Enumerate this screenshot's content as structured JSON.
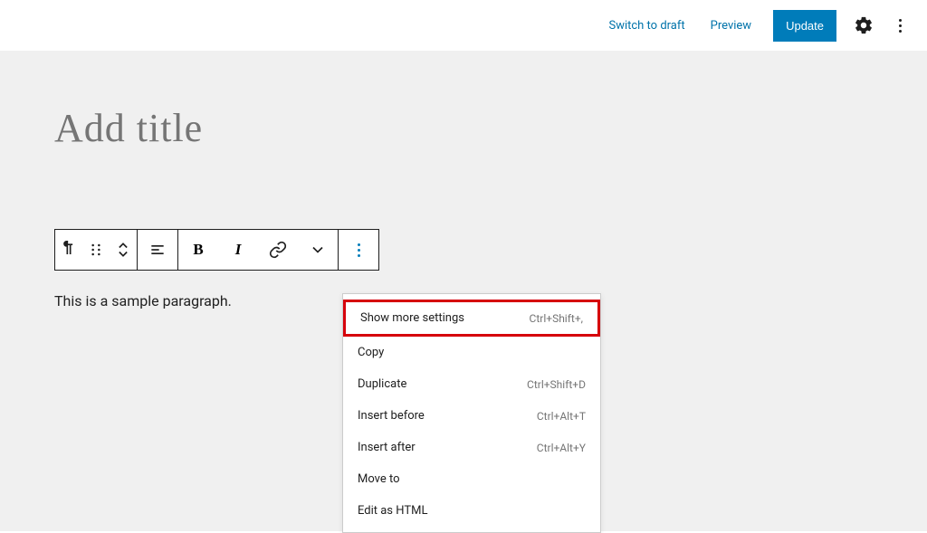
{
  "header": {
    "switch_draft": "Switch to draft",
    "preview": "Preview",
    "update": "Update"
  },
  "editor": {
    "title_placeholder": "Add title",
    "paragraph": "This is a sample paragraph."
  },
  "toolbar": {
    "bold_glyph": "B",
    "italic_glyph": "I"
  },
  "menu": {
    "items": [
      {
        "label": "Show more settings",
        "shortcut": "Ctrl+Shift+,",
        "highlighted": true
      },
      {
        "label": "Copy",
        "shortcut": ""
      },
      {
        "label": "Duplicate",
        "shortcut": "Ctrl+Shift+D"
      },
      {
        "label": "Insert before",
        "shortcut": "Ctrl+Alt+T"
      },
      {
        "label": "Insert after",
        "shortcut": "Ctrl+Alt+Y"
      },
      {
        "label": "Move to",
        "shortcut": ""
      },
      {
        "label": "Edit as HTML",
        "shortcut": ""
      }
    ]
  }
}
